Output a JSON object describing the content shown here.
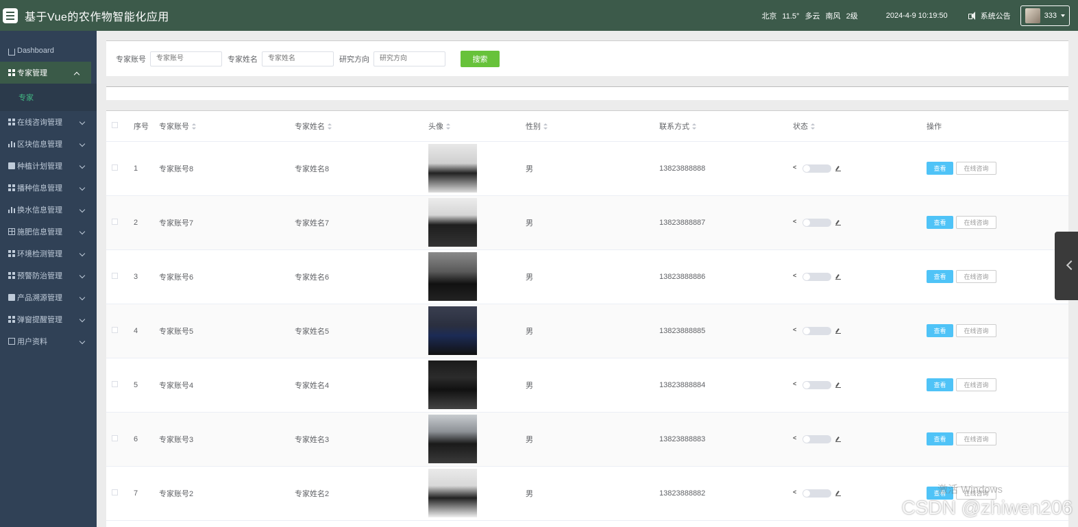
{
  "header": {
    "title": "基于Vue的农作物智能化应用",
    "weather": {
      "city": "北京",
      "temp": "11.5°",
      "condition": "多云",
      "wind": "南风",
      "level": "2级"
    },
    "datetime": "2024-4-9 10:19:50",
    "notice": "系统公告",
    "user": "333"
  },
  "sidebar": {
    "items": [
      {
        "label": "Dashboard"
      },
      {
        "label": "专家管理"
      },
      {
        "label": "在线咨询管理"
      },
      {
        "label": "区块信息管理"
      },
      {
        "label": "种植计划管理"
      },
      {
        "label": "播种信息管理"
      },
      {
        "label": "换水信息管理"
      },
      {
        "label": "施肥信息管理"
      },
      {
        "label": "环境检测管理"
      },
      {
        "label": "预警防治管理"
      },
      {
        "label": "产品溯源管理"
      },
      {
        "label": "弹窗提醒管理"
      },
      {
        "label": "用户资料"
      }
    ],
    "sub_item": "专家"
  },
  "search": {
    "account_label": "专家账号",
    "account_placeholder": "专家账号",
    "name_label": "专家姓名",
    "name_placeholder": "专家姓名",
    "direction_label": "研究方向",
    "direction_placeholder": "研究方向",
    "button": "搜索"
  },
  "table": {
    "headers": [
      "序号",
      "专家账号",
      "专家姓名",
      "头像",
      "性别",
      "联系方式",
      "状态",
      "操作"
    ],
    "view_label": "查看",
    "consult_label": "在线咨询",
    "rows": [
      {
        "idx": "1",
        "account": "专家账号8",
        "name": "专家姓名8",
        "gender": "男",
        "phone": "13823888888"
      },
      {
        "idx": "2",
        "account": "专家账号7",
        "name": "专家姓名7",
        "gender": "男",
        "phone": "13823888887"
      },
      {
        "idx": "3",
        "account": "专家账号6",
        "name": "专家姓名6",
        "gender": "男",
        "phone": "13823888886"
      },
      {
        "idx": "4",
        "account": "专家账号5",
        "name": "专家姓名5",
        "gender": "男",
        "phone": "13823888885"
      },
      {
        "idx": "5",
        "account": "专家账号4",
        "name": "专家姓名4",
        "gender": "男",
        "phone": "13823888884"
      },
      {
        "idx": "6",
        "account": "专家账号3",
        "name": "专家姓名3",
        "gender": "男",
        "phone": "13823888883"
      },
      {
        "idx": "7",
        "account": "专家账号2",
        "name": "专家姓名2",
        "gender": "男",
        "phone": "13823888882"
      }
    ]
  },
  "watermark": "CSDN @zhiwen206",
  "os_watermark": "激活 Windows"
}
